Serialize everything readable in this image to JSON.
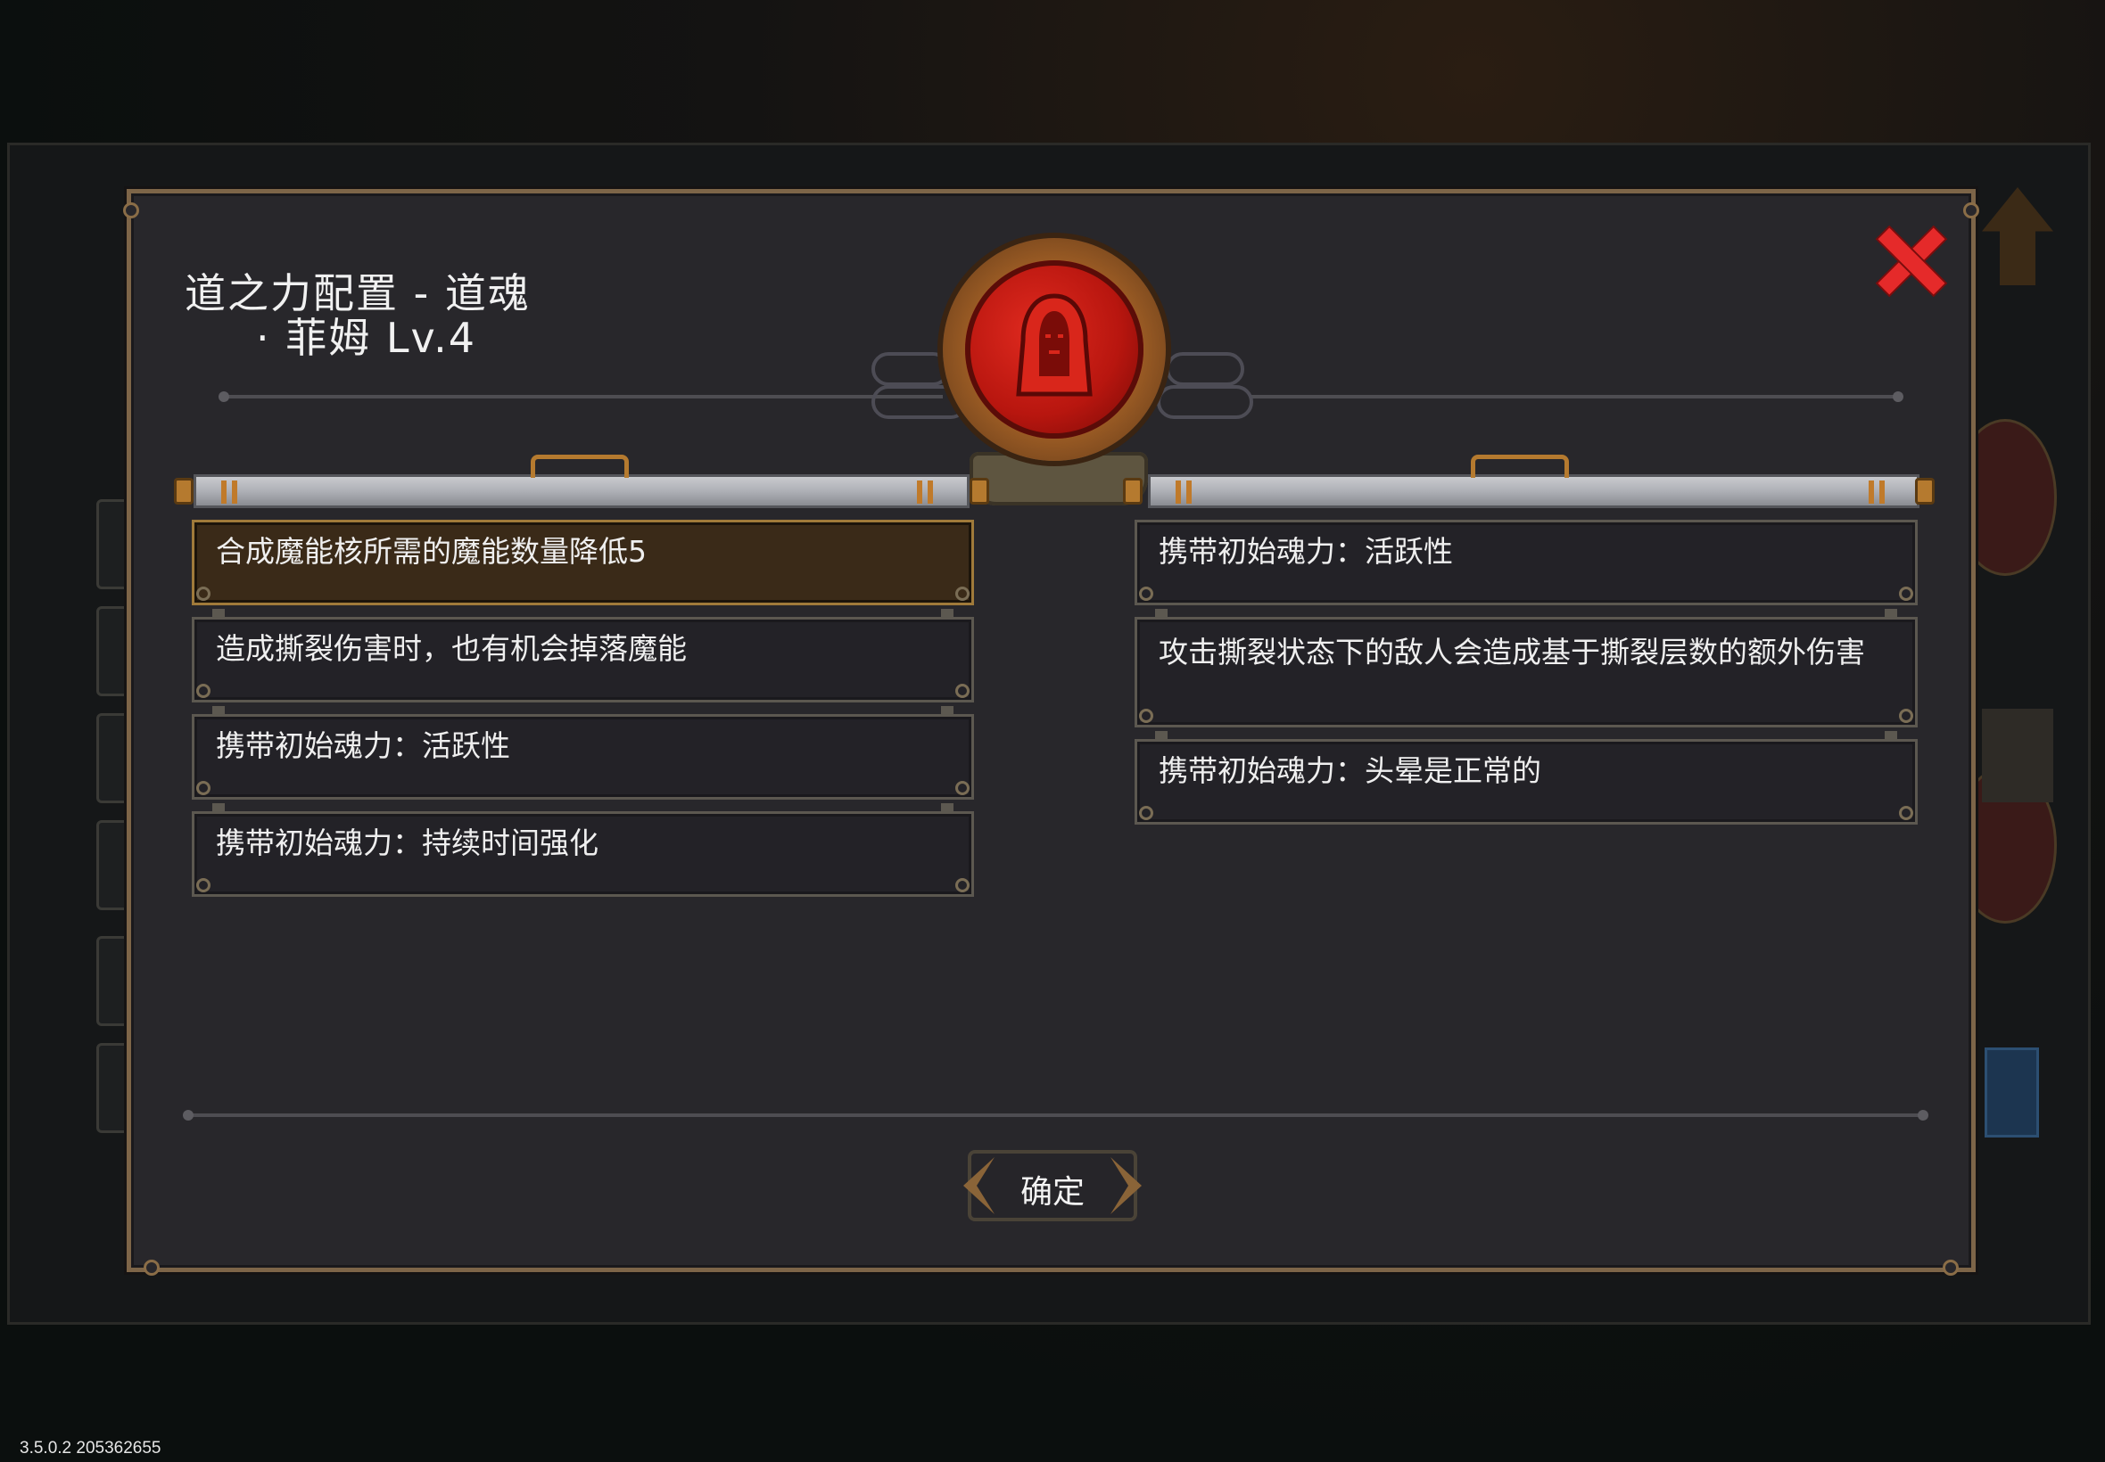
{
  "dialog": {
    "title_line1": "道之力配置 - 道魂",
    "title_line2": "· 菲姆 Lv.4",
    "close_icon": "close-x-icon",
    "accent_color": "#e52a2a"
  },
  "emblem": {
    "icon": "hooded-figure-portrait-icon"
  },
  "left_column": {
    "entries": [
      {
        "text": "合成魔能核所需的魔能数量降低5",
        "selected": true
      },
      {
        "text": "造成撕裂伤害时，也有机会掉落魔能",
        "selected": false
      },
      {
        "text": "携带初始魂力：活跃性",
        "selected": false
      },
      {
        "text": "携带初始魂力：持续时间强化",
        "selected": false
      }
    ]
  },
  "right_column": {
    "entries": [
      {
        "text": "携带初始魂力：活跃性",
        "selected": false
      },
      {
        "text": "攻击撕裂状态下的敌人会造成基于撕裂层数的额外伤害",
        "selected": false
      },
      {
        "text": "携带初始魂力：头晕是正常的",
        "selected": false
      }
    ]
  },
  "confirm_button": {
    "label": "确定"
  },
  "footer": {
    "version": "3.5.0.2 205362655"
  }
}
